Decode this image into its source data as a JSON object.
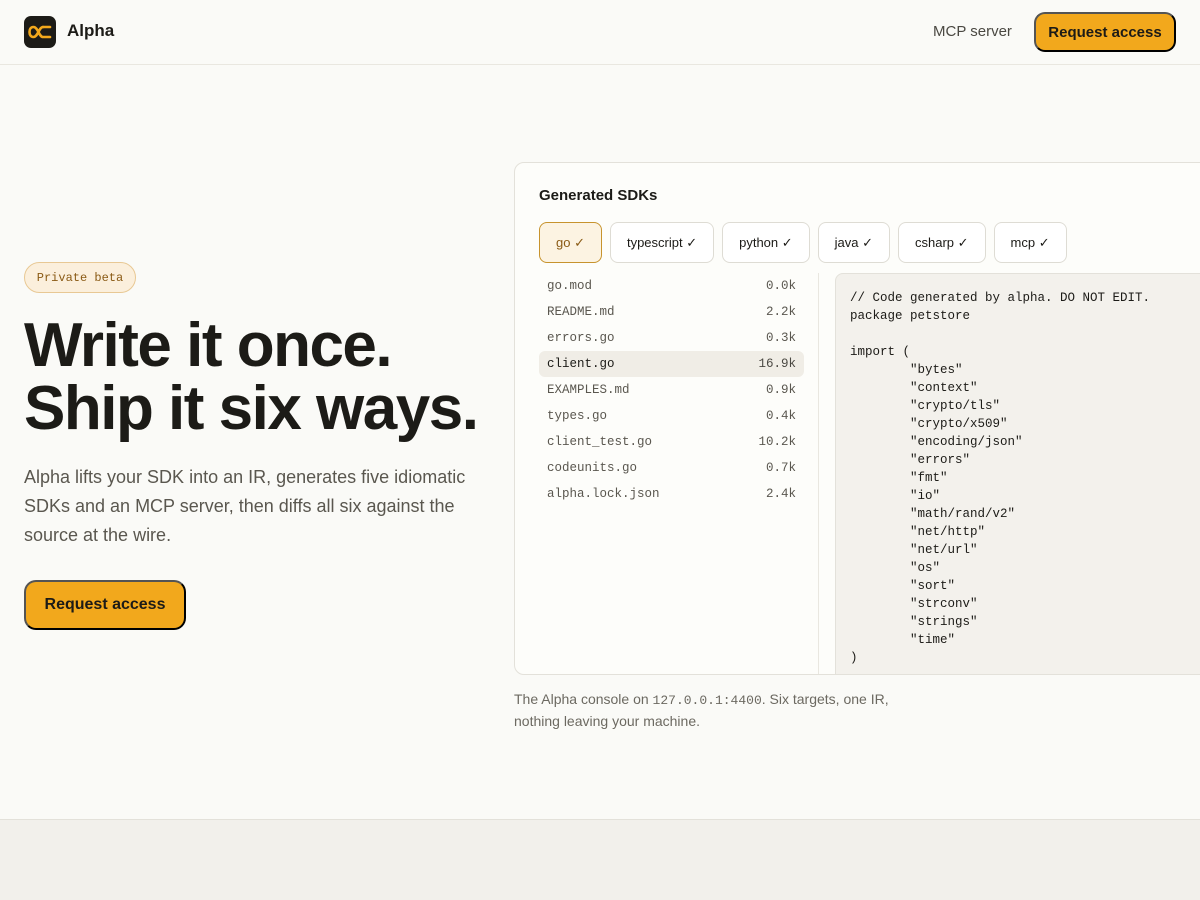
{
  "header": {
    "brand": "Alpha",
    "nav_link": "MCP server",
    "cta_label": "Request access"
  },
  "hero": {
    "badge": "Private beta",
    "headline_line1": "Write it once.",
    "headline_line2": "Ship it six ways.",
    "lede": "Alpha lifts your SDK into an IR, generates five idiomatic SDKs and an MCP server, then diffs all six against the source at the wire.",
    "cta_label": "Request access"
  },
  "console": {
    "title": "Generated SDKs",
    "tabs": [
      {
        "label": "go ✓",
        "active": true
      },
      {
        "label": "typescript ✓",
        "active": false
      },
      {
        "label": "python ✓",
        "active": false
      },
      {
        "label": "java ✓",
        "active": false
      },
      {
        "label": "csharp ✓",
        "active": false
      },
      {
        "label": "mcp ✓",
        "active": false
      }
    ],
    "files": [
      {
        "name": "go.mod",
        "size": "0.0k",
        "active": false
      },
      {
        "name": "README.md",
        "size": "2.2k",
        "active": false
      },
      {
        "name": "errors.go",
        "size": "0.3k",
        "active": false
      },
      {
        "name": "client.go",
        "size": "16.9k",
        "active": true
      },
      {
        "name": "EXAMPLES.md",
        "size": "0.9k",
        "active": false
      },
      {
        "name": "types.go",
        "size": "0.4k",
        "active": false
      },
      {
        "name": "client_test.go",
        "size": "10.2k",
        "active": false
      },
      {
        "name": "codeunits.go",
        "size": "0.7k",
        "active": false
      },
      {
        "name": "alpha.lock.json",
        "size": "2.4k",
        "active": false
      }
    ],
    "code": "// Code generated by alpha. DO NOT EDIT.\npackage petstore\n\nimport (\n        \"bytes\"\n        \"context\"\n        \"crypto/tls\"\n        \"crypto/x509\"\n        \"encoding/json\"\n        \"errors\"\n        \"fmt\"\n        \"io\"\n        \"math/rand/v2\"\n        \"net/http\"\n        \"net/url\"\n        \"os\"\n        \"sort\"\n        \"strconv\"\n        \"strings\"\n        \"time\"\n)"
  },
  "caption": {
    "prefix": "The Alpha console on ",
    "address": "127.0.0.1:4400",
    "suffix": ". Six targets, one IR, nothing leaving your machine."
  },
  "colors": {
    "accent": "#f2a81c",
    "background": "#fafaf7",
    "text": "#1c1b17"
  }
}
